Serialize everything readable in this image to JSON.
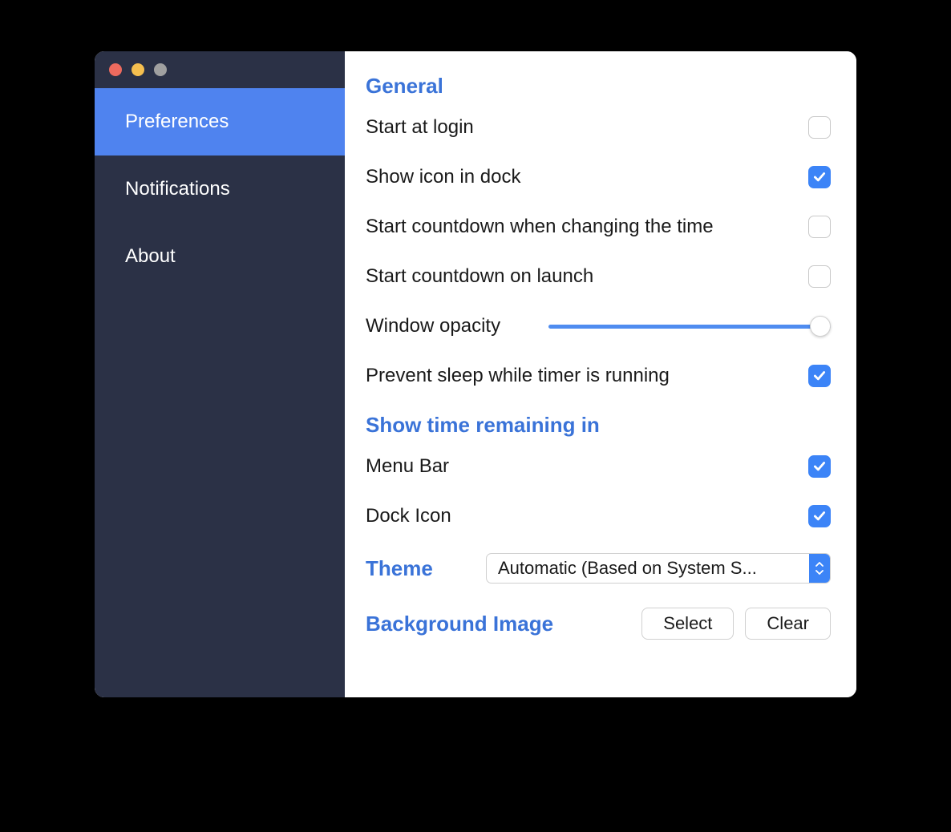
{
  "sidebar": {
    "items": [
      {
        "label": "Preferences",
        "active": true
      },
      {
        "label": "Notifications",
        "active": false
      },
      {
        "label": "About",
        "active": false
      }
    ]
  },
  "sections": {
    "general": {
      "heading": "General",
      "start_at_login": {
        "label": "Start at login",
        "checked": false
      },
      "show_icon_in_dock": {
        "label": "Show icon in dock",
        "checked": true
      },
      "start_countdown_change": {
        "label": "Start countdown when changing the time",
        "checked": false
      },
      "start_countdown_launch": {
        "label": "Start countdown on launch",
        "checked": false
      },
      "window_opacity": {
        "label": "Window opacity",
        "value": 100
      },
      "prevent_sleep": {
        "label": "Prevent sleep while timer is running",
        "checked": true
      }
    },
    "show_time": {
      "heading": "Show time remaining in",
      "menu_bar": {
        "label": "Menu Bar",
        "checked": true
      },
      "dock_icon": {
        "label": "Dock Icon",
        "checked": true
      }
    },
    "theme": {
      "heading": "Theme",
      "selected": "Automatic (Based on System S..."
    },
    "background_image": {
      "heading": "Background Image",
      "select_label": "Select",
      "clear_label": "Clear"
    }
  }
}
